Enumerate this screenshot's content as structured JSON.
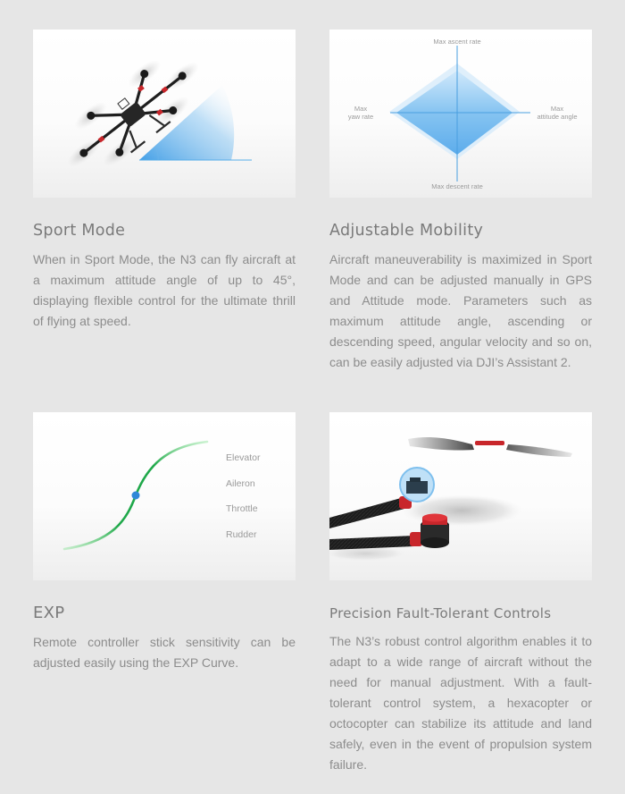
{
  "features": [
    {
      "title": "Sport Mode",
      "body": "When in Sport Mode, the N3 can fly aircraft at a maximum attitude angle of up to 45°, displaying flexible control for the ultimate thrill of flying at speed.",
      "image": "drone-tilted-attitude-angle"
    },
    {
      "title": "Adjustable Mobility",
      "body": "Aircraft maneuverability is maximized in Sport Mode and can be adjusted manually in GPS and Attitude mode. Parameters such as maximum attitude angle, ascending or descending speed, angular velocity and so on, can be easily adjusted via DJI’s Assistant 2.",
      "image": "mobility-radar-diagram",
      "diagram_labels": {
        "top": "Max ascent rate",
        "bottom": "Max descent rate",
        "left_line1": "Max",
        "left_line2": "yaw rate",
        "right_line1": "Max",
        "right_line2": "attitude angle"
      }
    },
    {
      "title": "EXP",
      "body": "Remote controller stick sensitivity can be adjusted easily using the EXP Curve.",
      "image": "exp-curve-diagram",
      "curve_labels": [
        "Elevator",
        "Aileron",
        "Throttle",
        "Rudder"
      ]
    },
    {
      "title": "Precision Fault-Tolerant Controls",
      "body": "The N3’s robust control algorithm enables it to adapt to a wide range of aircraft without the need for manual adjustment. With a fault-tolerant control system, a hexacopter or octocopter can stabilize its attitude and land safely, even in the event of propulsion system failure.",
      "image": "motor-arm-closeup"
    }
  ],
  "colors": {
    "background": "#e6e6e6",
    "title": "#7a7a7a",
    "body": "#8c8c8c",
    "accent_blue": "#3d9be9",
    "curve_green": "#22b14c",
    "motor_red": "#c8262b"
  }
}
